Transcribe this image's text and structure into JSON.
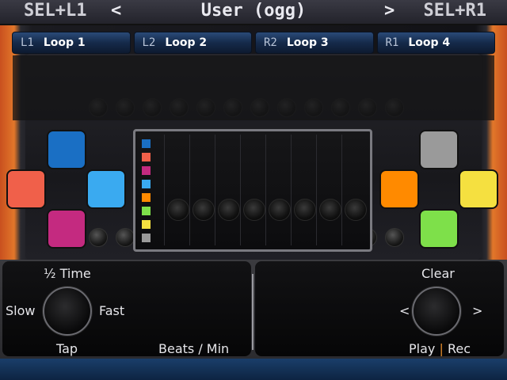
{
  "header": {
    "left_label": "SEL+L1",
    "left_arrow": "<",
    "title": "User (ogg)",
    "right_arrow": ">",
    "right_label": "SEL+R1"
  },
  "loops": [
    {
      "key": "L1",
      "name": "Loop 1"
    },
    {
      "key": "L2",
      "name": "Loop 2"
    },
    {
      "key": "R2",
      "name": "Loop 3"
    },
    {
      "key": "R1",
      "name": "Loop 4"
    }
  ],
  "pads": {
    "left": [
      {
        "name": "pad-left-top",
        "color": "#1a6fc4"
      },
      {
        "name": "pad-left-left",
        "color": "#f0604a"
      },
      {
        "name": "pad-left-right",
        "color": "#3aaaf0"
      },
      {
        "name": "pad-left-bottom",
        "color": "#c42a80"
      }
    ],
    "right": [
      {
        "name": "pad-right-top",
        "color": "#9a9a9a"
      },
      {
        "name": "pad-right-left",
        "color": "#ff8a00"
      },
      {
        "name": "pad-right-right",
        "color": "#f5e040"
      },
      {
        "name": "pad-right-bottom",
        "color": "#7ee04a"
      }
    ]
  },
  "legend_colors": [
    "#1a6fc4",
    "#f0604a",
    "#c42a80",
    "#3aaaf0",
    "#ff8a00",
    "#7ee04a",
    "#f5e040",
    "#9a9a9a"
  ],
  "tempo": {
    "half_time": "½ Time",
    "slow": "Slow",
    "fast": "Fast",
    "tap": "Tap",
    "unit": "Beats / Min"
  },
  "record": {
    "clear": "Clear",
    "prev": "<",
    "next": ">",
    "play": "Play",
    "separator": "|",
    "rec": "Rec"
  },
  "colors": {
    "tab_accent": "#2a4a78",
    "footer": "#1a3e6a"
  }
}
